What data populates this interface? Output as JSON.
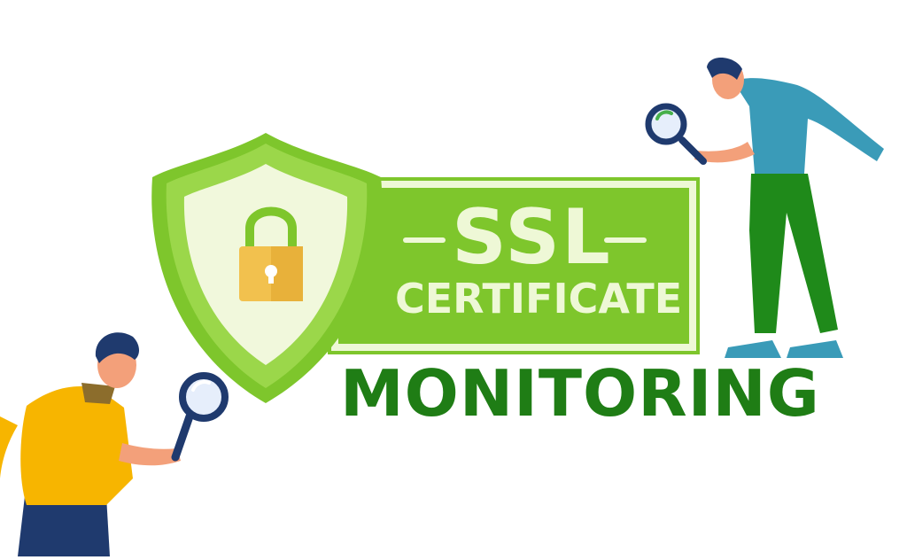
{
  "banner": {
    "line1": "SSL",
    "line2": "CERTIFICATE",
    "line3": "MONITORING"
  },
  "colors": {
    "panel_green": "#7ec62c",
    "panel_light": "#eef8d6",
    "shield_outer": "#8dd03a",
    "shield_inner": "#f1f8dc",
    "lock_gold": "#f2c14e",
    "monitoring_green": "#1f7d15"
  },
  "icons": {
    "shield": "shield-icon",
    "lock": "lock-icon",
    "magnifier": "magnifying-glass-icon"
  }
}
